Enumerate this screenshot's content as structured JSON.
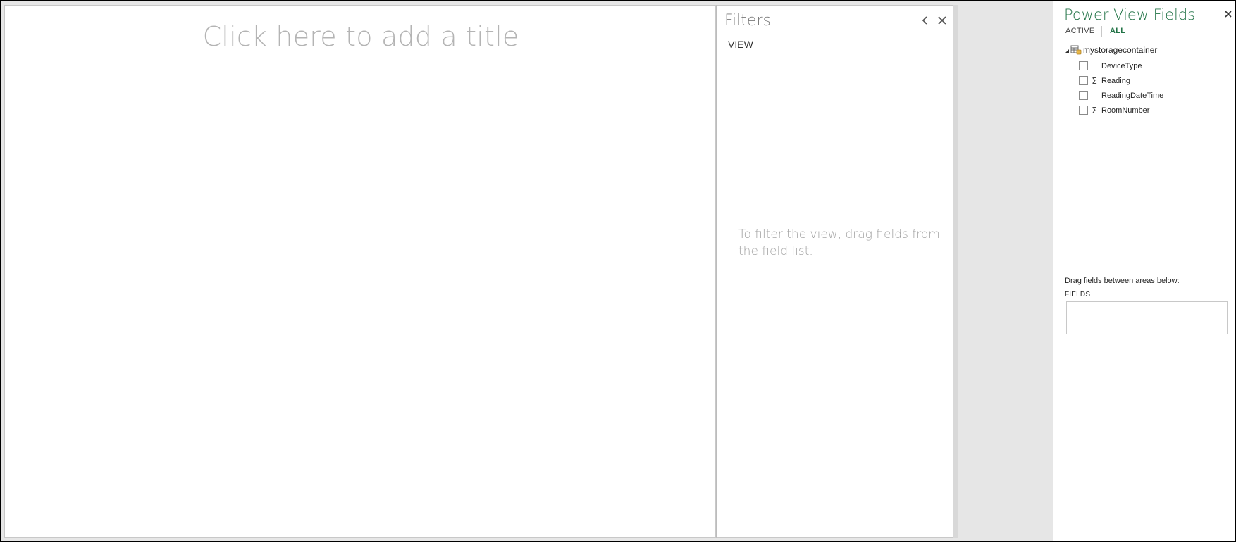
{
  "canvas": {
    "title_placeholder": "Click here to add a title"
  },
  "filters": {
    "title": "Filters",
    "view_label": "VIEW",
    "hint": "To filter the view, drag fields from the field list."
  },
  "field_list": {
    "title": "Power View Fields",
    "tabs": {
      "active": "ACTIVE",
      "all": "ALL"
    },
    "table_name": "mystoragecontainer",
    "fields": [
      {
        "label": "DeviceType",
        "sigma": ""
      },
      {
        "label": "Reading",
        "sigma": "Σ"
      },
      {
        "label": "ReadingDateTime",
        "sigma": ""
      },
      {
        "label": "RoomNumber",
        "sigma": "Σ"
      }
    ],
    "drag_hint": "Drag fields between areas below:",
    "fields_area_label": "FIELDS"
  },
  "colors": {
    "accent": "#217346",
    "placeholder_text": "#b4b4b4",
    "hint_text": "#a0a0a0"
  }
}
